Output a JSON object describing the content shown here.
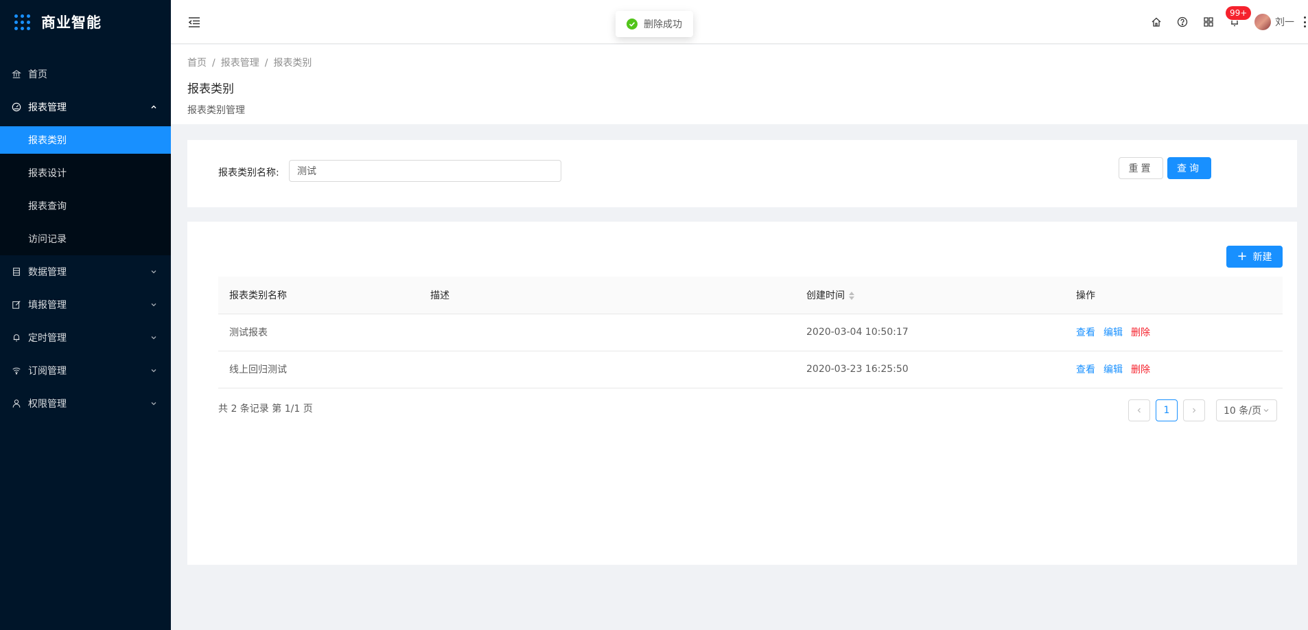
{
  "app": {
    "title": "商业智能"
  },
  "sidebar": {
    "items": [
      {
        "label": "首页",
        "icon": "bank-icon"
      },
      {
        "label": "报表管理",
        "icon": "dashboard-icon",
        "open": true,
        "children": [
          {
            "label": "报表类别",
            "active": true
          },
          {
            "label": "报表设计"
          },
          {
            "label": "报表查询"
          },
          {
            "label": "访问记录"
          }
        ]
      },
      {
        "label": "数据管理",
        "icon": "database-icon"
      },
      {
        "label": "填报管理",
        "icon": "form-icon"
      },
      {
        "label": "定时管理",
        "icon": "bell-icon"
      },
      {
        "label": "订阅管理",
        "icon": "wifi-icon"
      },
      {
        "label": "权限管理",
        "icon": "user-icon"
      }
    ]
  },
  "header": {
    "notification_count": "99+",
    "username": "刘一"
  },
  "toast": {
    "message": "删除成功"
  },
  "breadcrumb": [
    "首页",
    "报表管理",
    "报表类别"
  ],
  "page": {
    "title": "报表类别",
    "description": "报表类别管理"
  },
  "search": {
    "label": "报表类别名称:",
    "value": "测试",
    "reset_label": "重置",
    "query_label": "查询"
  },
  "table": {
    "new_label": "新建",
    "columns": [
      "报表类别名称",
      "描述",
      "创建时间",
      "操作"
    ],
    "rows": [
      {
        "name": "测试报表",
        "desc": "",
        "created": "2020-03-04 10:50:17"
      },
      {
        "name": "线上回归测试",
        "desc": "",
        "created": "2020-03-23 16:25:50"
      }
    ],
    "actions": {
      "view": "查看",
      "edit": "编辑",
      "delete": "删除"
    }
  },
  "pagination": {
    "summary": "共 2 条记录 第 1/1 页",
    "current": "1",
    "page_size": "10 条/页"
  },
  "colors": {
    "primary": "#1890ff",
    "danger": "#f5222d",
    "sider": "#001529",
    "success": "#52c41a"
  }
}
